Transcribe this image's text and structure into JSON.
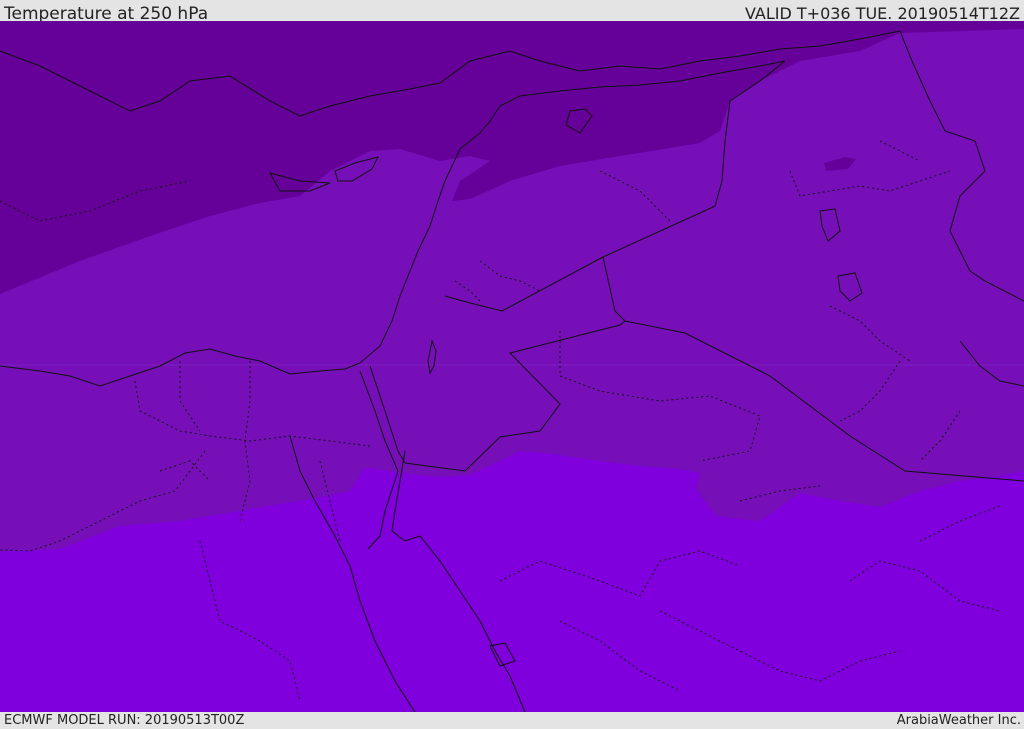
{
  "header": {
    "title": "Temperature at 250 hPa",
    "valid": "VALID T+036 TUE. 20190514T12Z"
  },
  "footer": {
    "model_run": "ECMWF MODEL RUN: 20190513T00Z",
    "credit": "ArabiaWeather Inc."
  },
  "map": {
    "colors": {
      "coldest": "#650098",
      "cold": "#7410b5",
      "mid": "#760fb8",
      "warm": "#7f00dc",
      "border": "#111111"
    }
  }
}
